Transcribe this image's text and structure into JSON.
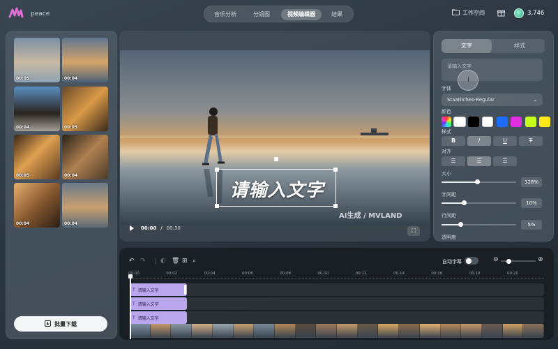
{
  "app": {
    "name": "peace"
  },
  "nav": {
    "tabs": [
      {
        "label": "音乐分析"
      },
      {
        "label": "分镜图"
      },
      {
        "label": "视频编辑器",
        "active": true
      },
      {
        "label": "结果"
      }
    ]
  },
  "header": {
    "workspace_label": "工作空间",
    "credits": "3,746"
  },
  "left": {
    "thumbnails": [
      {
        "time": "00:05"
      },
      {
        "time": "00:04"
      },
      {
        "time": "00:04"
      },
      {
        "time": "00:05"
      },
      {
        "time": "00:05"
      },
      {
        "time": "00:04"
      },
      {
        "time": "00:04"
      },
      {
        "time": "00:04"
      }
    ],
    "download_label": "批量下载"
  },
  "video": {
    "overlay_text": "请输入文字",
    "watermark": "AI生成 / MVLAND",
    "current_time": "00:00",
    "separator": " / ",
    "duration": "00:30"
  },
  "right": {
    "tabs": [
      {
        "label": "文字",
        "active": true
      },
      {
        "label": "样式"
      }
    ],
    "text_placeholder": "请输入文字",
    "font_label": "字体",
    "font_value": "Staatliches-Regular",
    "color_label": "颜色",
    "colors": [
      "#ffffff",
      "#000000",
      "#ffffff",
      "#1e6bff",
      "#e02ee0",
      "#c6ff1a",
      "#ffe81a"
    ],
    "style_label": "样式",
    "style_buttons": [
      "B",
      "I",
      "U",
      "T"
    ],
    "align_label": "对齐",
    "size_label": "大小",
    "size_value": "128%",
    "letter_spacing_label": "字间距",
    "letter_spacing_value": "10%",
    "line_spacing_label": "行间距",
    "line_spacing_value": "5%",
    "transparency_label": "透明度"
  },
  "timeline": {
    "auto_caption_label": "自动字幕",
    "auto_caption_on": false,
    "ticks": [
      "00:00",
      "00:02",
      "00:04",
      "00:06",
      "00:08",
      "00:10",
      "00:12",
      "00:14",
      "00:16",
      "00:18",
      "00:20"
    ],
    "text_clips": [
      "请输入文字",
      "请输入文字",
      "请输入文字"
    ]
  }
}
